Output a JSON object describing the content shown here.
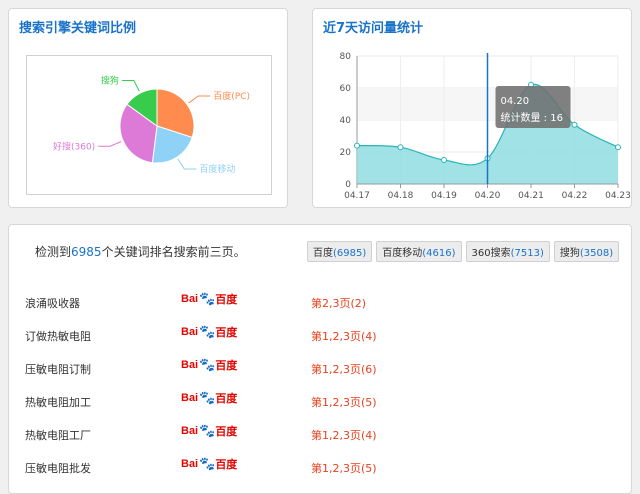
{
  "pie_panel": {
    "title": "搜索引擎关键词比例"
  },
  "line_panel": {
    "title": "近7天访问量统计",
    "tooltip": {
      "date": "04.20",
      "label": "统计数量 : 16"
    }
  },
  "colors": {
    "baidu_pc": "#ff8b4f",
    "baidu_mobile": "#8fd2f7",
    "haosou": "#dd79d6",
    "sogou": "#37cc4b",
    "line": "#2bb3b8",
    "area": "#8fdde1",
    "cursor": "#1a73c9",
    "title": "#1a73c9"
  },
  "chart_data": [
    {
      "type": "pie",
      "categories": [
        "百度(PC)",
        "百度移动",
        "好搜(360)",
        "搜狗"
      ],
      "values": [
        30,
        22,
        33,
        15
      ]
    },
    {
      "type": "area",
      "x": [
        "04.17",
        "04.18",
        "04.19",
        "04.20",
        "04.21",
        "04.22",
        "04.23"
      ],
      "values": [
        24,
        23,
        15,
        16,
        62,
        37,
        23
      ],
      "ylim": [
        0,
        80
      ],
      "yticks": [
        "0",
        "20",
        "40",
        "60",
        "80"
      ],
      "grid": true
    }
  ],
  "keywords_panel": {
    "summary_prefix": "检测到",
    "summary_count": "6985",
    "summary_suffix": "个关键词排名搜索前三页。",
    "tabs": [
      {
        "name": "百度",
        "count": "(6985)"
      },
      {
        "name": "百度移动",
        "count": "(4616)"
      },
      {
        "name": "360搜索",
        "count": "(7513)"
      },
      {
        "name": "搜狗",
        "count": "(3508)"
      }
    ],
    "rows": [
      {
        "keyword": "浪涌吸收器",
        "engine_logo": "Bai百度",
        "rank": "第2,3页(2)"
      },
      {
        "keyword": "订做热敏电阻",
        "engine_logo": "Bai百度",
        "rank": "第1,2,3页(4)"
      },
      {
        "keyword": "压敏电阻订制",
        "engine_logo": "Bai百度",
        "rank": "第1,2,3页(6)"
      },
      {
        "keyword": "热敏电阻加工",
        "engine_logo": "Bai百度",
        "rank": "第1,2,3页(5)"
      },
      {
        "keyword": "热敏电阻工厂",
        "engine_logo": "Bai百度",
        "rank": "第1,2,3页(4)"
      },
      {
        "keyword": "压敏电阻批发",
        "engine_logo": "Bai百度",
        "rank": "第1,2,3页(5)"
      }
    ]
  }
}
